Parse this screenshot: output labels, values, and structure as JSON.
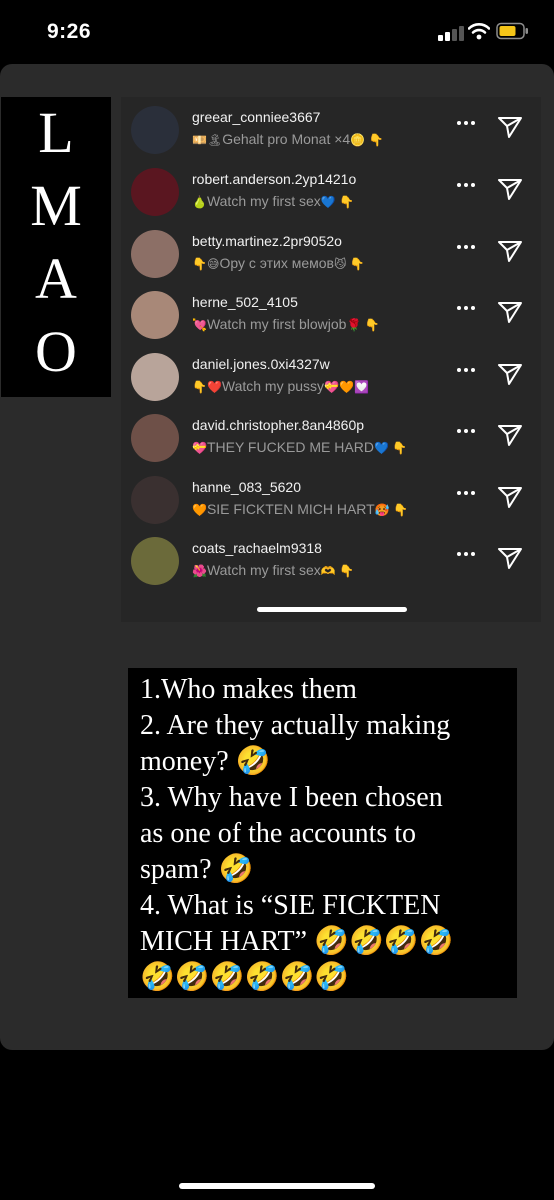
{
  "status_bar": {
    "time": "9:26",
    "battery_color": "#f5c518"
  },
  "sidebar_text": [
    "L",
    "M",
    "A",
    "O"
  ],
  "dm_list": {
    "rows": [
      {
        "username": "greear_conniee3667",
        "message": "Gehalt pro Monat ×4",
        "emoji_before": "💴🏝",
        "emoji_after": "🪙 👇",
        "avatar_color": "#2a2f3a"
      },
      {
        "username": "robert.anderson.2yp1421o",
        "message": "Watch my first sex",
        "emoji_before": "🍐",
        "emoji_after": "💙 👇",
        "avatar_color": "#5a1620"
      },
      {
        "username": "betty.martinez.2pr9052o",
        "message": "Ору с этих мемов",
        "emoji_before": "👇😅",
        "emoji_after": "😼 👇",
        "avatar_color": "#8c6f66"
      },
      {
        "username": "herne_502_4105",
        "message": "Watch my first blowjob",
        "emoji_before": "💘",
        "emoji_after": "🌹 👇",
        "avatar_color": "#a88878"
      },
      {
        "username": "daniel.jones.0xi4327w",
        "message": "Watch my pussy",
        "emoji_before": "👇❤️",
        "emoji_after": "💝🧡💟",
        "avatar_color": "#b8a49a"
      },
      {
        "username": "david.christopher.8an4860p",
        "message": "THEY FUCKED ME HARD",
        "emoji_before": "💝",
        "emoji_after": "💙 👇",
        "avatar_color": "#6e5048"
      },
      {
        "username": "hanne_083_5620",
        "message": "SIE FICKTEN MICH HART",
        "emoji_before": "🧡",
        "emoji_after": "🥵 👇",
        "avatar_color": "#3a3030"
      },
      {
        "username": "coats_rachaelm9318",
        "message": "Watch my first sex",
        "emoji_before": "🌺",
        "emoji_after": "🫶 👇",
        "avatar_color": "#6b6a3a"
      }
    ]
  },
  "caption": {
    "lines": [
      "1.Who makes them",
      "2. Are they actually making",
      "money? 🤣",
      "3. Why have  I been chosen",
      "as one of the accounts to",
      "spam? 🤣",
      "4. What is “SIE FICKTEN",
      "MICH HART” 🤣🤣🤣🤣",
      "🤣🤣🤣🤣🤣🤣"
    ]
  }
}
